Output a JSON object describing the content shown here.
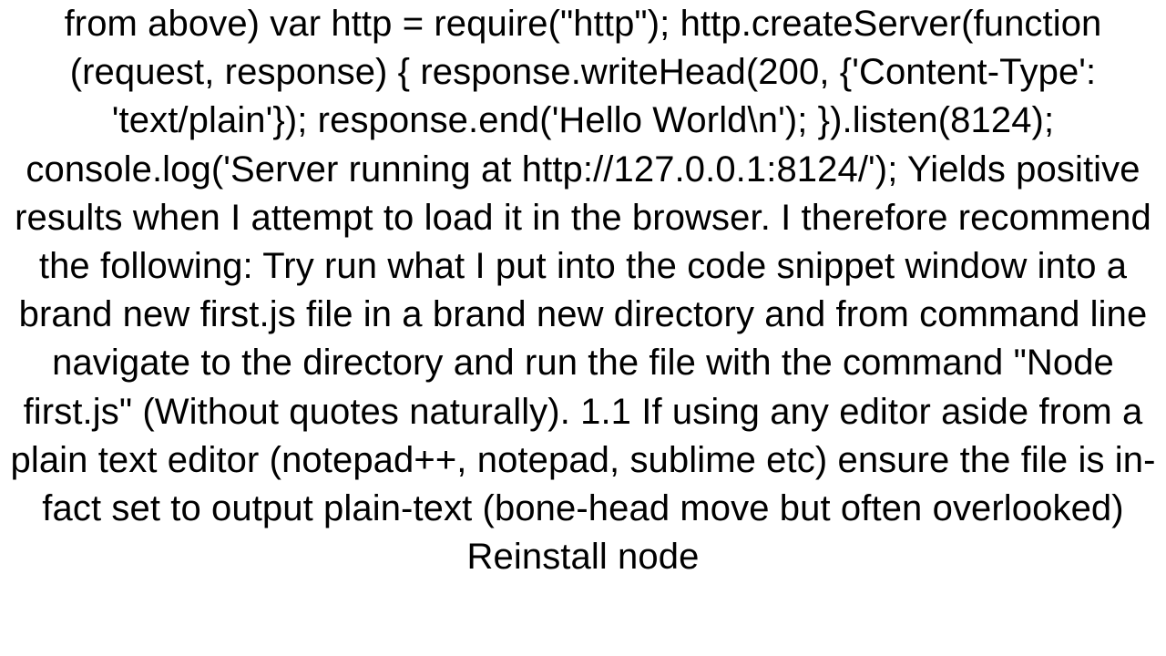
{
  "body": {
    "text": "from above) var http = require(\"http\"); http.createServer(function (request, response) { response.writeHead(200, {'Content-Type': 'text/plain'}); response.end('Hello World\\n'); }).listen(8124); console.log('Server running at http://127.0.0.1:8124/'); Yields positive results when I attempt to load it in the browser. I therefore recommend the following:  Try run what I put into the code snippet window into a brand new first.js file in a brand new directory and from command line navigate to the directory and run the file with the command \"Node first.js\" (Without quotes naturally).  1.1 If using any editor aside from a plain text editor (notepad++, notepad, sublime etc) ensure the file is in-fact set to output plain-text (bone-head move but often overlooked)  Reinstall node"
  }
}
